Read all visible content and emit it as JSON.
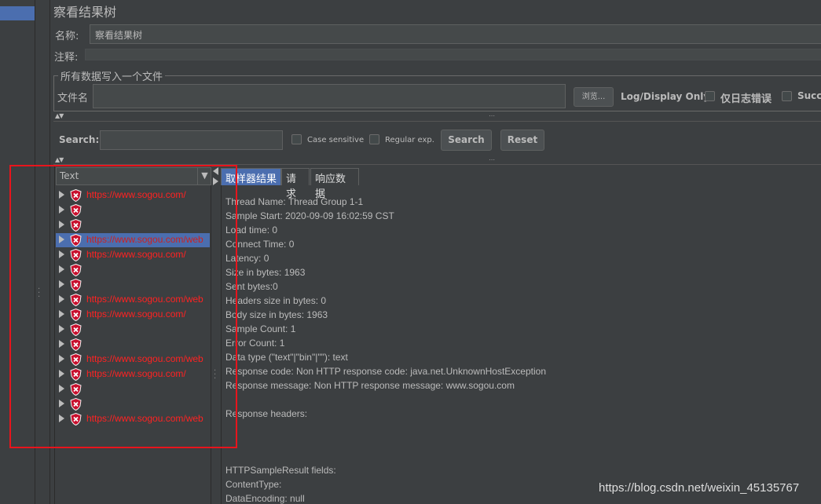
{
  "panel": {
    "title": "察看结果树"
  },
  "fields": {
    "name_label": "名称:",
    "name_value": "察看结果树",
    "comment_label": "注释:"
  },
  "file_group": {
    "title": "所有数据写入一个文件",
    "file_label": "文件名",
    "browse_label": "浏览...",
    "log_display_label": "Log/Display Only:",
    "errors_label": "仅日志错误",
    "success_label": "Succ"
  },
  "search": {
    "label": "Search:",
    "case_label": "Case sensitive",
    "regex_label": "Regular exp.",
    "search_button": "Search",
    "reset_button": "Reset"
  },
  "tree": {
    "renderer": "Text",
    "rows": [
      {
        "label": "https://www.sogou.com/",
        "selected": false
      },
      {
        "label": "",
        "selected": false
      },
      {
        "label": "",
        "selected": false
      },
      {
        "label": "https://www.sogou.com/web",
        "selected": true
      },
      {
        "label": "https://www.sogou.com/",
        "selected": false
      },
      {
        "label": "",
        "selected": false
      },
      {
        "label": "",
        "selected": false
      },
      {
        "label": "https://www.sogou.com/web",
        "selected": false
      },
      {
        "label": "https://www.sogou.com/",
        "selected": false
      },
      {
        "label": "",
        "selected": false
      },
      {
        "label": "",
        "selected": false
      },
      {
        "label": "https://www.sogou.com/web",
        "selected": false
      },
      {
        "label": "https://www.sogou.com/",
        "selected": false
      },
      {
        "label": "",
        "selected": false
      },
      {
        "label": "",
        "selected": false
      },
      {
        "label": "https://www.sogou.com/web",
        "selected": false
      }
    ]
  },
  "tabs": [
    {
      "label": "取样器结果",
      "active": true
    },
    {
      "label": "请求",
      "active": false
    },
    {
      "label": "响应数据",
      "active": false
    }
  ],
  "result": {
    "lines": [
      "Thread Name: Thread Group 1-1",
      "Sample Start: 2020-09-09 16:02:59 CST",
      "Load time: 0",
      "Connect Time: 0",
      "Latency: 0",
      "Size in bytes: 1963",
      "Sent bytes:0",
      "Headers size in bytes: 0",
      "Body size in bytes: 1963",
      "Sample Count: 1",
      "Error Count: 1",
      "Data type (\"text\"|\"bin\"|\"\"): text",
      "Response code: Non HTTP response code: java.net.UnknownHostException",
      "Response message: Non HTTP response message: www.sogou.com",
      "",
      "Response headers:",
      "",
      "",
      "",
      "HTTPSampleResult fields:",
      "ContentType:",
      "DataEncoding: null"
    ]
  },
  "watermark": "https://blog.csdn.net/weixin_45135767",
  "colors": {
    "error_text": "#ff2222",
    "selection": "#4b6eaf",
    "highlight_box": "#e8141c"
  }
}
